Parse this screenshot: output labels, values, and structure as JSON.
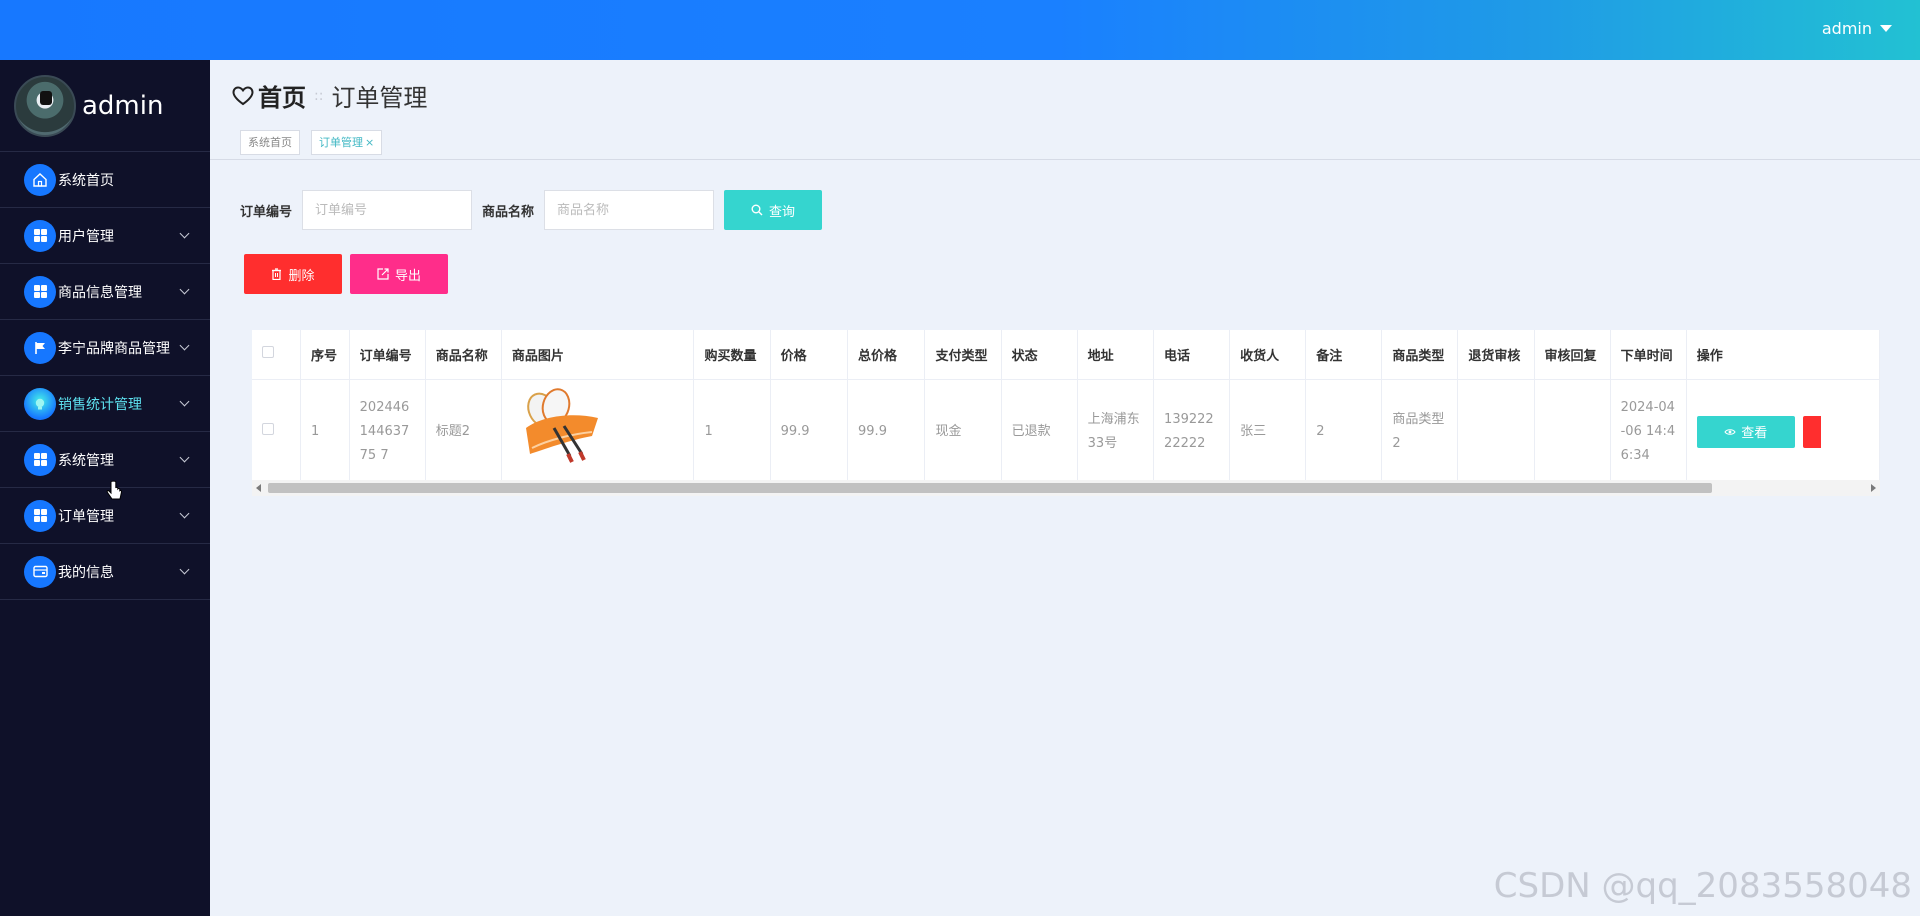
{
  "topbar": {
    "user_label": "admin"
  },
  "profile": {
    "name": "admin"
  },
  "sidebar": {
    "items": [
      {
        "label": "系统首页",
        "icon": "home-icon"
      },
      {
        "label": "用户管理",
        "icon": "grid-icon"
      },
      {
        "label": "商品信息管理",
        "icon": "grid-icon"
      },
      {
        "label": "李宁品牌商品管理",
        "icon": "flag-icon"
      },
      {
        "label": "销售统计管理",
        "icon": "bulb-icon"
      },
      {
        "label": "系统管理",
        "icon": "grid-icon"
      },
      {
        "label": "订单管理",
        "icon": "grid-icon"
      },
      {
        "label": "我的信息",
        "icon": "wallet-icon"
      }
    ]
  },
  "breadcrumb": {
    "home": "首页",
    "separator": "::",
    "current": "订单管理"
  },
  "tabs": [
    {
      "label": "系统首页"
    },
    {
      "label": "订单管理",
      "close": "×"
    }
  ],
  "search": {
    "order_no_label": "订单编号",
    "order_no_placeholder": "订单编号",
    "product_name_label": "商品名称",
    "product_name_placeholder": "商品名称",
    "query_label": "查询"
  },
  "actions": {
    "delete_label": "删除",
    "export_label": "导出"
  },
  "table": {
    "headers": [
      "序号",
      "订单编号",
      "商品名称",
      "商品图片",
      "购买数量",
      "价格",
      "总价格",
      "支付类型",
      "状态",
      "地址",
      "电话",
      "收货人",
      "备注",
      "商品类型",
      "退货审核",
      "审核回复",
      "下单时间",
      "操作"
    ],
    "rows": [
      {
        "index": "1",
        "order_no": "20244614463775 7",
        "product_name": "标题2",
        "quantity": "1",
        "price": "99.9",
        "total": "99.9",
        "pay_type": "现金",
        "status": "已退款",
        "address": "上海浦东33号",
        "phone": "13922222222",
        "receiver": "张三",
        "note": "2",
        "product_type": "商品类型2",
        "return_review": "",
        "review_reply": "",
        "order_time": "2024-04-06 14:46:34",
        "view_label": "查看"
      }
    ]
  },
  "watermark": "CSDN @qq_2083558048",
  "colors": {
    "accent": "#35d5cf",
    "danger": "#ff2e2e",
    "export": "#ff2d8a",
    "sidebar": "#0f1129",
    "topbar": "#1778ff"
  }
}
